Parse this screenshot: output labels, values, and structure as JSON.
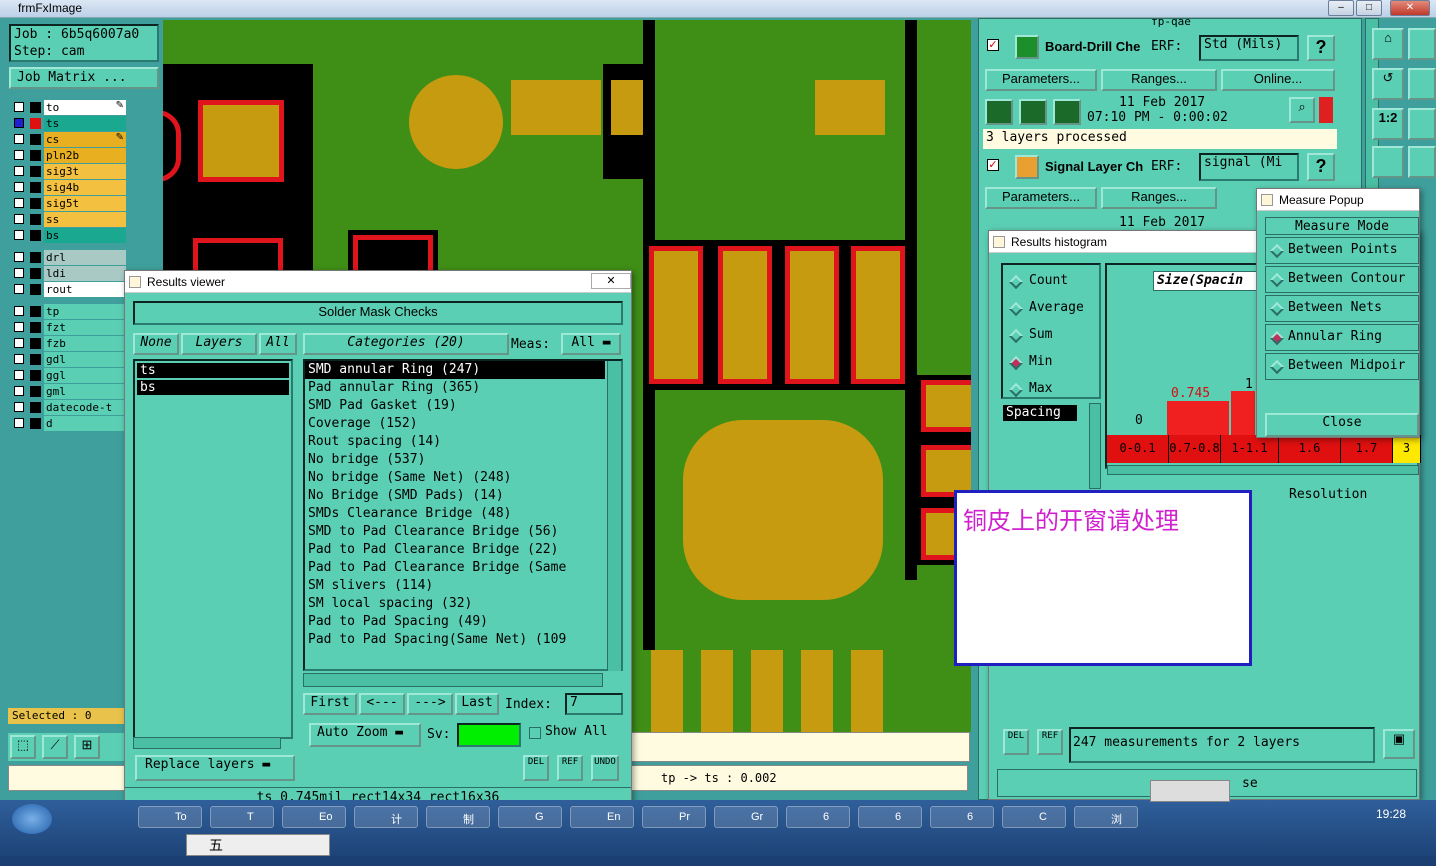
{
  "window": {
    "title": "frmFxImage",
    "btn_min": "–",
    "btn_max": "□",
    "btn_close": "✕"
  },
  "job": {
    "job_line": "Job : 6b5q6007a0",
    "step_line": "Step: cam",
    "matrix_btn": "Job Matrix ..."
  },
  "layers": [
    {
      "name": "to",
      "color": "#ffffff",
      "mark": true
    },
    {
      "name": "ts",
      "color": "#1aa890",
      "mark": false,
      "sel": true
    },
    {
      "name": "cs",
      "color": "#e8b020",
      "mark": true
    },
    {
      "name": "pln2b",
      "color": "#e8b020"
    },
    {
      "name": "sig3t",
      "color": "#f4c040"
    },
    {
      "name": "sig4b",
      "color": "#f4c040"
    },
    {
      "name": "sig5t",
      "color": "#f4c040"
    },
    {
      "name": "ss",
      "color": "#f4c040"
    },
    {
      "name": "bs",
      "color": "#1aa890"
    },
    {
      "name": "drl",
      "color": "#a9c9c4"
    },
    {
      "name": "ldi",
      "color": "#a9c9c4"
    },
    {
      "name": "rout",
      "color": "#ffffff"
    },
    {
      "name": "tp",
      "color": "#5bcfb4"
    },
    {
      "name": "fzt",
      "color": "#5bcfb4"
    },
    {
      "name": "fzb",
      "color": "#5bcfb4"
    },
    {
      "name": "gdl",
      "color": "#5bcfb4"
    },
    {
      "name": "ggl",
      "color": "#5bcfb4"
    },
    {
      "name": "gml",
      "color": "#5bcfb4"
    },
    {
      "name": "datecode-t",
      "color": "#5bcfb4"
    },
    {
      "name": "d",
      "color": "#5bcfb4"
    }
  ],
  "selected_label": "Selected : 0",
  "results_viewer": {
    "title": "Results viewer",
    "heading": "Solder Mask Checks",
    "none_btn": "None",
    "layers_btn": "Layers",
    "all_btn": "All",
    "categories_btn": "Categories (20)",
    "meas_label": "Meas:",
    "meas_value": "All",
    "layer_list": [
      "ts",
      "bs"
    ],
    "categories": [
      "SMD annular Ring (247)",
      "Pad annular Ring (365)",
      "SMD Pad Gasket (19)",
      "Coverage (152)",
      "Rout spacing (14)",
      "No bridge (537)",
      "No bridge (Same Net) (248)",
      "No Bridge (SMD Pads) (14)",
      "SMDs Clearance Bridge (48)",
      "SMD to Pad Clearance Bridge (56)",
      "Pad to Pad Clearance Bridge (22)",
      "Pad to Pad Clearance Bridge (Same",
      "SM slivers (114)",
      "SM local spacing (32)",
      "Pad to Pad Spacing (49)",
      "Pad to Pad Spacing(Same Net) (109"
    ],
    "first_btn": "First",
    "prev_btn": "<---",
    "next_btn": "--->",
    "last_btn": "Last",
    "index_label": "Index:",
    "index_value": "7",
    "auto_zoom": "Auto Zoom",
    "sv_label": "Sv:",
    "show_all": "Show All",
    "replace_layers": "Replace layers",
    "del": "DEL",
    "ref": "REF",
    "undo": "UNDO",
    "status": "ts 0.745mil   rect14x34   rect16x36"
  },
  "status_bar": {
    "tp_ts": "tp -> ts : 0.002"
  },
  "checklist": {
    "title": "fp-qae",
    "row1": {
      "name": "Board-Drill Che",
      "erf": "ERF:",
      "erf_value": "Std (Mils)",
      "help": "?"
    },
    "row1_btns": [
      "Parameters...",
      "Ranges...",
      "Online..."
    ],
    "row1_date": "11 Feb 2017",
    "row1_time": "07:10 PM - 0:00:02",
    "row1_status": "3 layers processed",
    "row2": {
      "name": "Signal Layer Ch",
      "erf": "ERF:",
      "erf_value": "signal (Mi",
      "help": "?"
    },
    "row2_btns": [
      "Parameters...",
      "Ranges..."
    ],
    "row2_date": "11 Feb 2017"
  },
  "histogram": {
    "title": "Results histogram",
    "options": [
      "Count",
      "Average",
      "Sum",
      "Min",
      "Max"
    ],
    "selected_option": "Min",
    "size_label": "Size(Spacin",
    "spacing": "Spacing",
    "bar_value_label": "0.745",
    "y_zero": "0",
    "y_one": "1",
    "bins": [
      "0-0.1",
      "0.7-0.8",
      "1-1.1",
      "1.6",
      "1.7",
      "3"
    ],
    "resolution": "Resolution",
    "footer": "247 measurements for 2 layers",
    "del": "DEL",
    "ref": "REF"
  },
  "measure_popup": {
    "title": "Measure Popup",
    "mode_label": "Measure Mode",
    "modes": [
      "Between Points",
      "Between Contour",
      "Between Nets",
      "Annular Ring",
      "Between Midpoir"
    ],
    "selected_mode": "Annular Ring",
    "close": "Close"
  },
  "note": {
    "text": "铜皮上的开窗请处理"
  },
  "tray": {
    "se": "se",
    "time": "19:28",
    "ime": "五"
  },
  "taskbar": {
    "items": [
      "To",
      "T",
      "Eo",
      "计",
      "制",
      "G",
      "En",
      "Pr",
      "Gr",
      "6",
      "6",
      "6",
      "C",
      "浏"
    ]
  }
}
